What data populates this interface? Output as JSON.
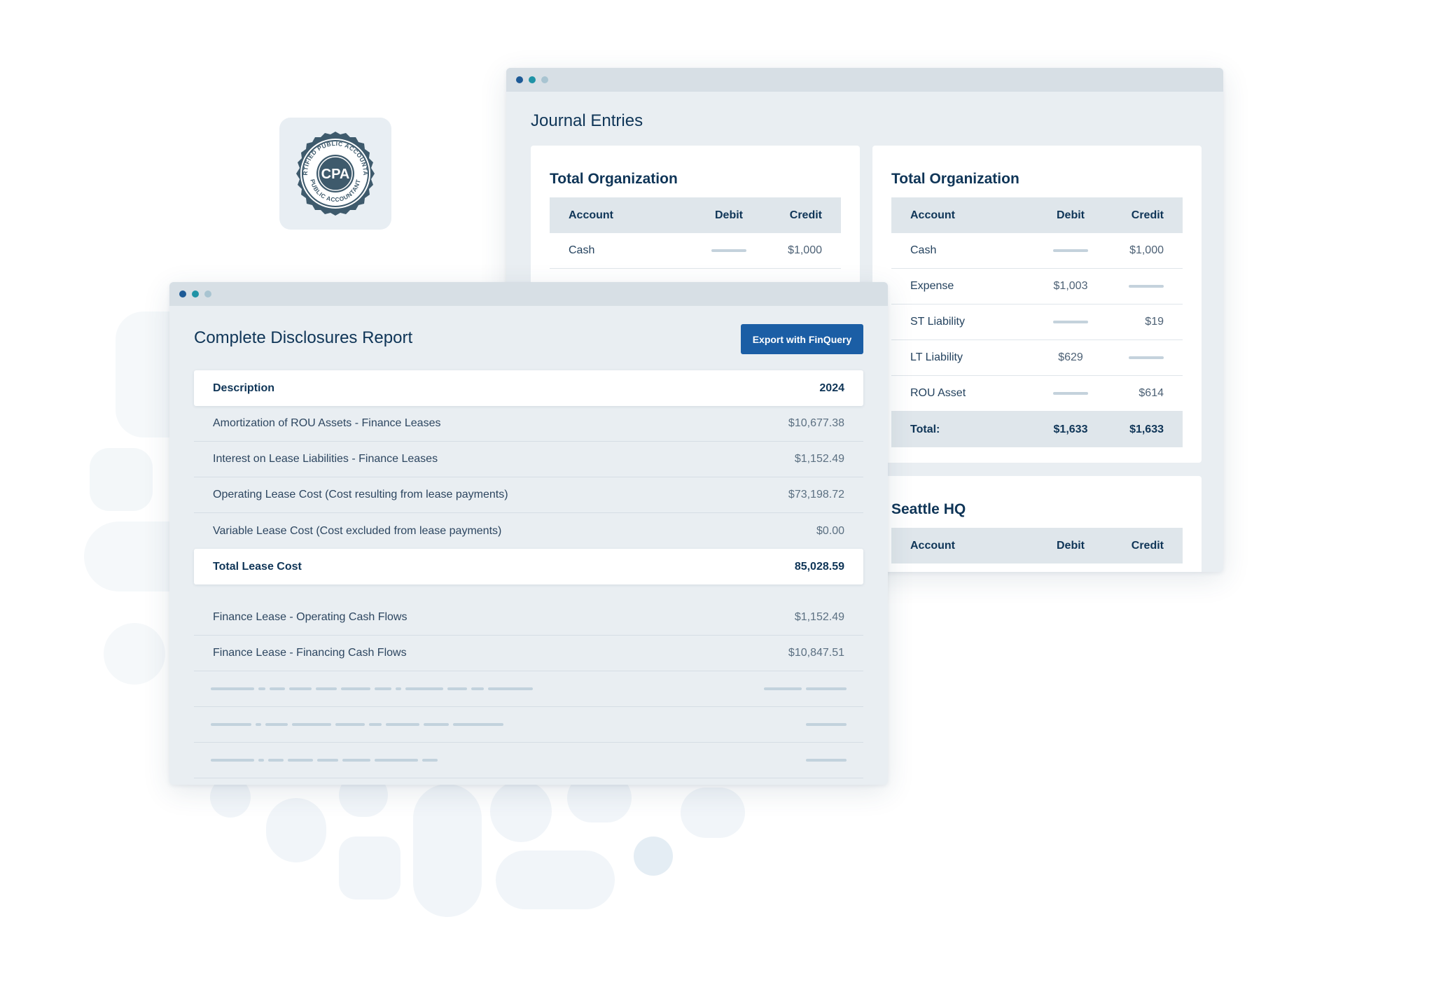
{
  "colors": {
    "accent": "#1b5ea5",
    "dot_dark": "#1d5a96",
    "dot_teal": "#1f93a6",
    "dot_light": "#a8c4d1"
  },
  "badge": {
    "icon": "cpa-seal-icon",
    "center_text": "CPA",
    "ring_top": "CERTIFIED PUBLIC ACCOUNTANT",
    "ring_bottom": "PUBLIC ACCOUNTANT"
  },
  "journal": {
    "title": "Journal Entries",
    "cards": [
      {
        "title": "Total Organization",
        "headers": {
          "account": "Account",
          "debit": "Debit",
          "credit": "Credit"
        },
        "rows": [
          {
            "account": "Cash",
            "debit": "",
            "credit": "$1,000"
          }
        ]
      },
      {
        "title": "Total Organization",
        "headers": {
          "account": "Account",
          "debit": "Debit",
          "credit": "Credit"
        },
        "rows": [
          {
            "account": "Cash",
            "debit": "",
            "credit": "$1,000"
          },
          {
            "account": "Expense",
            "debit": "$1,003",
            "credit": ""
          },
          {
            "account": "ST Liability",
            "debit": "",
            "credit": "$19"
          },
          {
            "account": "LT Liability",
            "debit": "$629",
            "credit": ""
          },
          {
            "account": "ROU Asset",
            "debit": "",
            "credit": "$614"
          }
        ],
        "total": {
          "label": "Total:",
          "debit": "$1,633",
          "credit": "$1,633"
        }
      },
      {
        "title": "Seattle HQ",
        "headers": {
          "account": "Account",
          "debit": "Debit",
          "credit": "Credit"
        },
        "rows": []
      }
    ]
  },
  "disclosures": {
    "title": "Complete Disclosures Report",
    "export_label": "Export with FinQuery",
    "header": {
      "description": "Description",
      "year": "2024"
    },
    "rows": [
      {
        "description": "Amortization of ROU Assets - Finance Leases",
        "value": "$10,677.38"
      },
      {
        "description": "Interest on Lease Liabilities - Finance Leases",
        "value": "$1,152.49"
      },
      {
        "description": "Operating Lease Cost (Cost resulting from lease payments)",
        "value": "$73,198.72"
      },
      {
        "description": "Variable Lease Cost (Cost excluded from lease payments)",
        "value": "$0.00"
      }
    ],
    "total": {
      "description": "Total Lease Cost",
      "value": "85,028.59"
    },
    "cash_rows": [
      {
        "description": "Finance Lease - Operating Cash Flows",
        "value": "$1,152.49"
      },
      {
        "description": "Finance Lease - Financing Cash Flows",
        "value": "$10,847.51"
      }
    ]
  }
}
